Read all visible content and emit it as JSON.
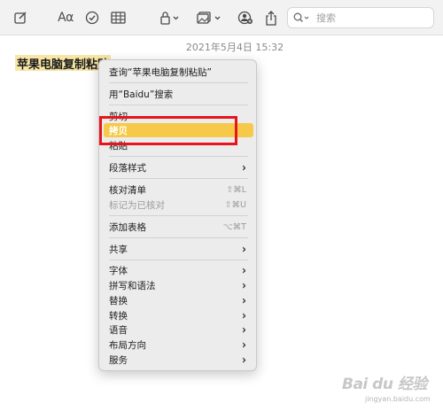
{
  "toolbar": {
    "icons": [
      "compose-icon",
      "font-icon",
      "checklist-icon",
      "table-icon",
      "lock-icon",
      "media-icon",
      "collaborate-icon",
      "share-icon",
      "search-icon"
    ],
    "font_label": "Aα",
    "search_placeholder": "搜索"
  },
  "note": {
    "timestamp": "2021年5月4日 15:32",
    "title": "苹果电脑复制粘贴"
  },
  "context_menu": {
    "items": [
      {
        "label": "查询“苹果电脑复制粘贴”"
      },
      {
        "label": "用“Baidu”搜索"
      },
      {
        "label": "剪切"
      },
      {
        "label": "拷贝",
        "highlighted": true
      },
      {
        "label": "粘贴"
      },
      {
        "label": "段落样式",
        "submenu": true
      },
      {
        "label": "核对清单",
        "shortcut": "⇧⌘L"
      },
      {
        "label": "标记为已核对",
        "shortcut": "⇧⌘U",
        "disabled": true
      },
      {
        "label": "添加表格",
        "shortcut": "⌥⌘T"
      },
      {
        "label": "共享",
        "submenu": true
      },
      {
        "label": "字体",
        "submenu": true
      },
      {
        "label": "拼写和语法",
        "submenu": true
      },
      {
        "label": "替换",
        "submenu": true
      },
      {
        "label": "转换",
        "submenu": true
      },
      {
        "label": "语音",
        "submenu": true
      },
      {
        "label": "布局方向",
        "submenu": true
      },
      {
        "label": "服务",
        "submenu": true
      }
    ],
    "chevron": "›",
    "highlight_color": "#f7c94a"
  },
  "watermark": {
    "logo": "Bai du 经验",
    "url": "jingyan.baidu.com"
  }
}
